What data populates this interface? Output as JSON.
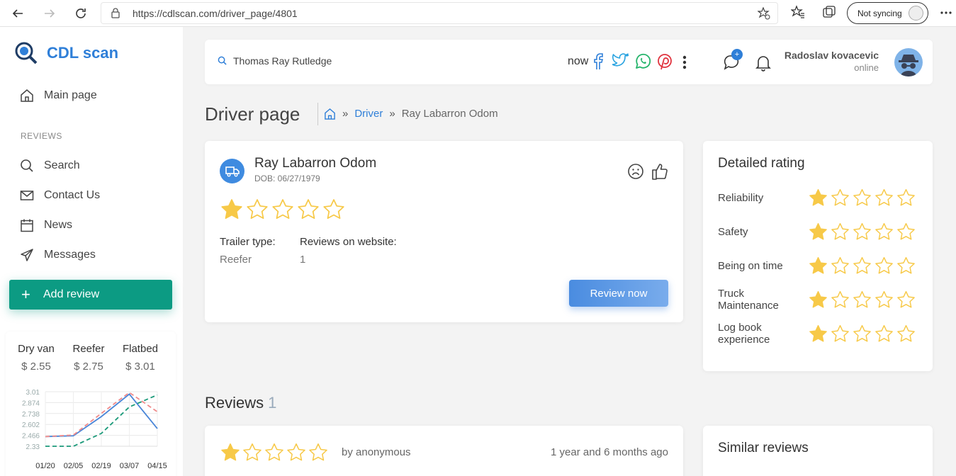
{
  "browser": {
    "url": "https://cdlscan.com/driver_page/4801",
    "sync_label": "Not syncing"
  },
  "sidebar": {
    "brand": "CDL scan",
    "main_page": "Main page",
    "section_label": "REVIEWS",
    "items": [
      {
        "label": "Search",
        "icon": "search-icon"
      },
      {
        "label": "Contact Us",
        "icon": "mail-icon"
      },
      {
        "label": "News",
        "icon": "calendar-icon"
      },
      {
        "label": "Messages",
        "icon": "send-icon"
      }
    ],
    "add_review": "Add review"
  },
  "rates": {
    "columns": [
      {
        "name": "Dry van",
        "price": "$ 2.55"
      },
      {
        "name": "Reefer",
        "price": "$ 2.75"
      },
      {
        "name": "Flatbed",
        "price": "$ 3.01"
      }
    ]
  },
  "chart_data": {
    "type": "line",
    "x": [
      "01/20",
      "02/05",
      "02/19",
      "03/07",
      "04/15"
    ],
    "y_ticks": [
      "3.01",
      "2.874",
      "2.738",
      "2.602",
      "2.466",
      "2.33"
    ],
    "ylim": [
      2.33,
      3.01
    ],
    "series": [
      {
        "values": [
          2.45,
          2.46,
          2.7,
          2.98,
          2.55
        ],
        "color": "#4a86d8",
        "dashed": false
      },
      {
        "values": [
          2.45,
          2.47,
          2.74,
          3.0,
          2.76
        ],
        "color": "#f08a8a",
        "dashed": true
      },
      {
        "values": [
          2.33,
          2.33,
          2.49,
          2.82,
          2.97
        ],
        "color": "#1b9a7a",
        "dashed": true
      }
    ]
  },
  "topbar": {
    "search_value": "Thomas Ray Rutledge",
    "share_text": "now",
    "notif_badge": "+",
    "user_name": "Radoslav kovacevic",
    "user_status": "online"
  },
  "page": {
    "title": "Driver page",
    "breadcrumb_link": "Driver",
    "breadcrumb_current": "Ray Labarron Odom"
  },
  "driver": {
    "name": "Ray Labarron Odom",
    "dob": "DOB: 06/27/1979",
    "rating": 1,
    "trailer_label": "Trailer type:",
    "trailer_value": "Reefer",
    "reviews_label": "Reviews on website:",
    "reviews_value": "1",
    "review_button": "Review now"
  },
  "detailed_rating": {
    "title": "Detailed rating",
    "rows": [
      {
        "label": "Reliability",
        "stars": 1
      },
      {
        "label": "Safety",
        "stars": 1
      },
      {
        "label": "Being on time",
        "stars": 1
      },
      {
        "label": "Truck Maintenance",
        "stars": 1
      },
      {
        "label": "Log book experience",
        "stars": 1
      }
    ]
  },
  "reviews": {
    "heading": "Reviews",
    "count": "1",
    "items": [
      {
        "stars": 1,
        "author": "by anonymous",
        "time": "1 year and 6 months ago"
      }
    ]
  },
  "similar": {
    "title": "Similar reviews"
  },
  "colors": {
    "accent": "#2f7fd8",
    "add_review": "#0c9b83",
    "star": "#f7c948"
  }
}
